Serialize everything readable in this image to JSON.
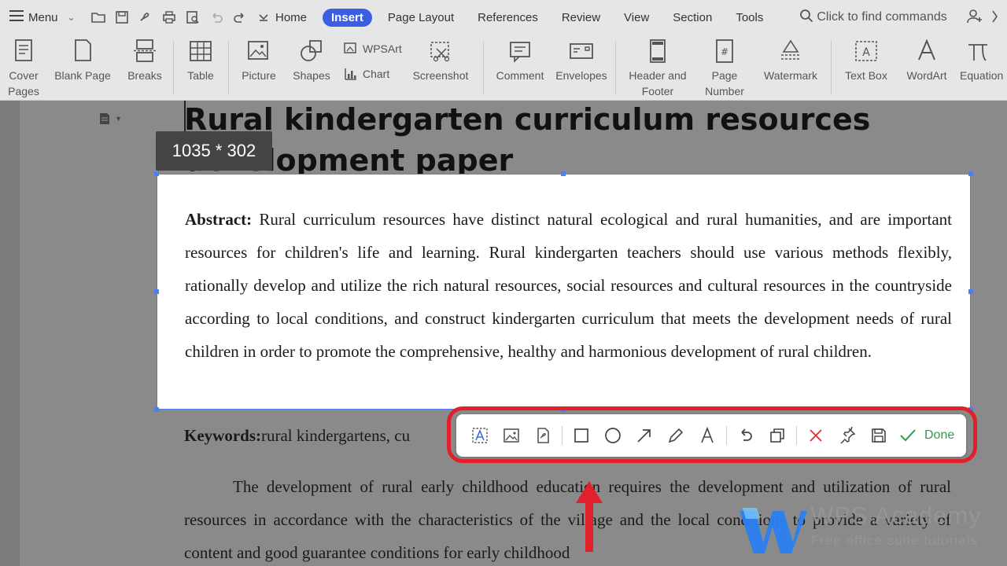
{
  "menubar": {
    "menu_label": "Menu",
    "tabs": [
      "Home",
      "Insert",
      "Page Layout",
      "References",
      "Review",
      "View",
      "Section",
      "Tools"
    ],
    "active_tab": "Insert",
    "search_placeholder": "Click to find commands"
  },
  "ribbon": {
    "cover_pages": "Cover Pages",
    "blank_page": "Blank Page",
    "breaks": "Breaks",
    "table": "Table",
    "picture": "Picture",
    "shapes": "Shapes",
    "wpsart": "WPSArt",
    "chart": "Chart",
    "screenshot": "Screenshot",
    "comment": "Comment",
    "envelopes": "Envelopes",
    "header_footer_1": "Header and",
    "header_footer_2": "Footer",
    "page_number_1": "Page",
    "page_number_2": "Number",
    "watermark": "Watermark",
    "text_box": "Text Box",
    "wordart": "WordArt",
    "equation": "Equation"
  },
  "document": {
    "title": "Rural kindergarten curriculum resources development paper",
    "abstract_label": "Abstract:",
    "abstract_text": " Rural curriculum resources have distinct natural ecological and rural humanities, and are important resources for children's life and learning. Rural kindergarten teachers should use various methods flexibly, rationally develop and utilize the rich natural resources, social resources and cultural resources in the countryside according to local conditions, and construct kindergarten curriculum that meets the development needs of rural children in order to promote the comprehensive, healthy and harmonious development of rural children.",
    "keywords_label": "Keywords:",
    "keywords_text": "rural kindergartens, cu",
    "paragraph": "The development of rural early childhood education requires the development and utilization of rural resources in accordance with the characteristics of the village and the local conditions to provide a variety of content and good guarantee conditions for early childhood"
  },
  "screenshot_tool": {
    "size_readout": "1035 * 302",
    "done_label": "Done"
  },
  "watermark": {
    "title": "WPS Academy",
    "subtitle": "Free office suite tutorials"
  }
}
